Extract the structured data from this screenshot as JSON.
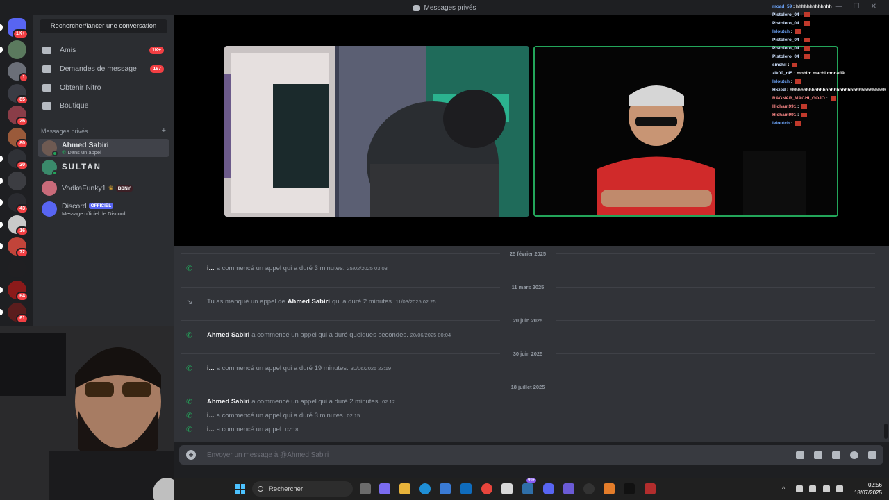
{
  "window": {
    "title": "Messages privés"
  },
  "servers": [
    {
      "badge": "1K+",
      "color": "#5865f2",
      "pill": true
    },
    {
      "badge": "",
      "color": "#5b7a5e",
      "pill": true
    },
    {
      "badge": "1",
      "color": "#6b6f78",
      "pill": false
    },
    {
      "badge": "85",
      "color": "#3a3c44",
      "pill": false
    },
    {
      "badge": "26",
      "color": "#8a3d48",
      "pill": false
    },
    {
      "badge": "80",
      "color": "#9a5a3a",
      "pill": false
    },
    {
      "badge": "20",
      "color": "#2f3136",
      "pill": true
    },
    {
      "badge": "",
      "color": "#3c3d42",
      "pill": true
    },
    {
      "badge": "43",
      "color": "#2a2b30",
      "pill": true
    },
    {
      "badge": "16",
      "color": "#c9c9c9",
      "pill": true
    },
    {
      "badge": "72",
      "color": "#c2443a",
      "pill": true
    },
    {
      "badge": "",
      "color": "#1f1f22",
      "pill": false
    },
    {
      "badge": "64",
      "color": "#8b1a1a",
      "pill": true
    },
    {
      "badge": "61",
      "color": "#5a1d1d",
      "pill": true
    }
  ],
  "sidebar": {
    "search_label": "Rechercher/lancer une conversation",
    "nav": [
      {
        "label": "Amis",
        "count": "1K+",
        "icon": "friends-icon"
      },
      {
        "label": "Demandes de message",
        "count": "167",
        "icon": "mail-icon"
      },
      {
        "label": "Obtenir Nitro",
        "count": "",
        "icon": "nitro-icon"
      },
      {
        "label": "Boutique",
        "count": "",
        "icon": "shop-icon"
      }
    ],
    "dm_header": "Messages privés",
    "dm_add": "+",
    "dms": [
      {
        "name": "Ahmed Sabiri",
        "sub": "Dans un appel",
        "active": true,
        "tag": "",
        "avatar": "#6e5a52"
      },
      {
        "name": "SULTAN",
        "sub": "",
        "active": false,
        "tag": "",
        "avatar": "#3a8a6b"
      },
      {
        "name": "VodkaFunky1",
        "sub": "",
        "active": false,
        "tag": "BBNY",
        "avatar": "#c96b7a"
      },
      {
        "name": "Discord",
        "sub": "Message officiel de Discord",
        "active": false,
        "tag": "OFFICIEL",
        "avatar": "#5865f2"
      }
    ]
  },
  "chat": {
    "dates": [
      "25 février 2025",
      "11 mars 2025",
      "20 juin 2025",
      "30 juin 2025",
      "18 juillet 2025"
    ],
    "messages": [
      {
        "who": "i...",
        "text": "a commencé un appel qui a duré 3 minutes.",
        "time": "25/02/2025 03:03",
        "missed": false,
        "pre": ""
      },
      {
        "who": "Ahmed Sabiri",
        "text": "qui a duré 2 minutes.",
        "time": "11/03/2025 02:25",
        "missed": true,
        "pre": "Tu as manqué un appel de"
      },
      {
        "who": "Ahmed Sabiri",
        "text": "a commencé un appel qui a duré quelques secondes.",
        "time": "20/06/2025 00:04",
        "missed": false,
        "pre": ""
      },
      {
        "who": "i...",
        "text": "a commencé un appel qui a duré 19 minutes.",
        "time": "30/06/2025 23:19",
        "missed": false,
        "pre": ""
      },
      {
        "who": "Ahmed Sabiri",
        "text": "a commencé un appel qui a duré 2 minutes.",
        "time": "02:12",
        "missed": false,
        "pre": ""
      },
      {
        "who": "i...",
        "text": "a commencé un appel qui a duré 3 minutes.",
        "time": "02:15",
        "missed": false,
        "pre": ""
      },
      {
        "who": "i...",
        "text": "a commencé un appel.",
        "time": "02:18",
        "missed": false,
        "pre": ""
      }
    ],
    "composer_placeholder": "Envoyer un message à @Ahmed Sabiri"
  },
  "stream_chat": [
    {
      "user": "moad_59",
      "msg": "hhhhhhhhhhhhh"
    },
    {
      "user": "Pistolero_04",
      "msg": ""
    },
    {
      "user": "Pistolero_04",
      "msg": ""
    },
    {
      "user": "leloutch",
      "msg": ""
    },
    {
      "user": "Pistolero_04",
      "msg": ""
    },
    {
      "user": "Pistolero_04",
      "msg": ""
    },
    {
      "user": "Pistolero_04",
      "msg": ""
    },
    {
      "user": "sinchil",
      "msg": ""
    },
    {
      "user": "zik00_r45",
      "msg": "mohim machi monafi9"
    },
    {
      "user": "leloutch",
      "msg": ""
    },
    {
      "user": "Hxzed",
      "msg": "hhhhhhhhhhhhhhhhhhhhhhhhhhhhhhhhhhh"
    },
    {
      "user": "RAGNAR_MACHI_GOJO",
      "msg": ""
    },
    {
      "user": "Hicham991",
      "msg": ""
    },
    {
      "user": "Hicham991",
      "msg": ""
    },
    {
      "user": "leloutch",
      "msg": ""
    }
  ],
  "taskbar": {
    "search_label": "Rechercher",
    "time": "02:56",
    "date": "18/07/2025",
    "badge": "99+"
  }
}
